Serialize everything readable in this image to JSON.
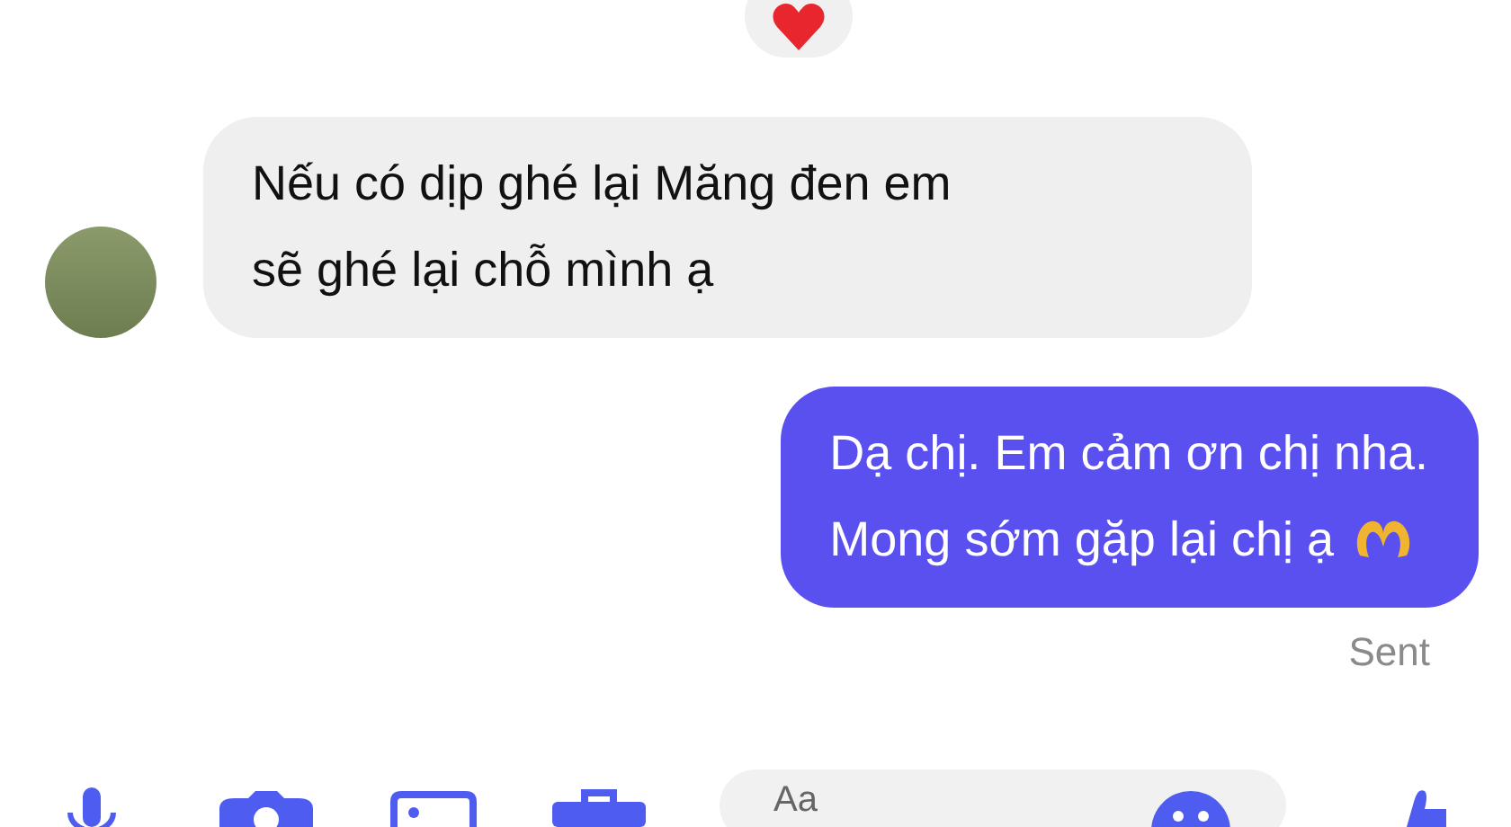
{
  "messages": [
    {
      "kind": "received",
      "lines": [
        "Nếu có dịp ghé lại Măng đen em",
        "sẽ ghé lại chỗ mình ạ"
      ]
    },
    {
      "kind": "sent",
      "lines": [
        "Dạ chị. Em cảm ơn chị nha.",
        "Mong sớm gặp lại chị ạ"
      ],
      "status": "Sent"
    }
  ],
  "composer": {
    "placeholder": "Aa"
  }
}
